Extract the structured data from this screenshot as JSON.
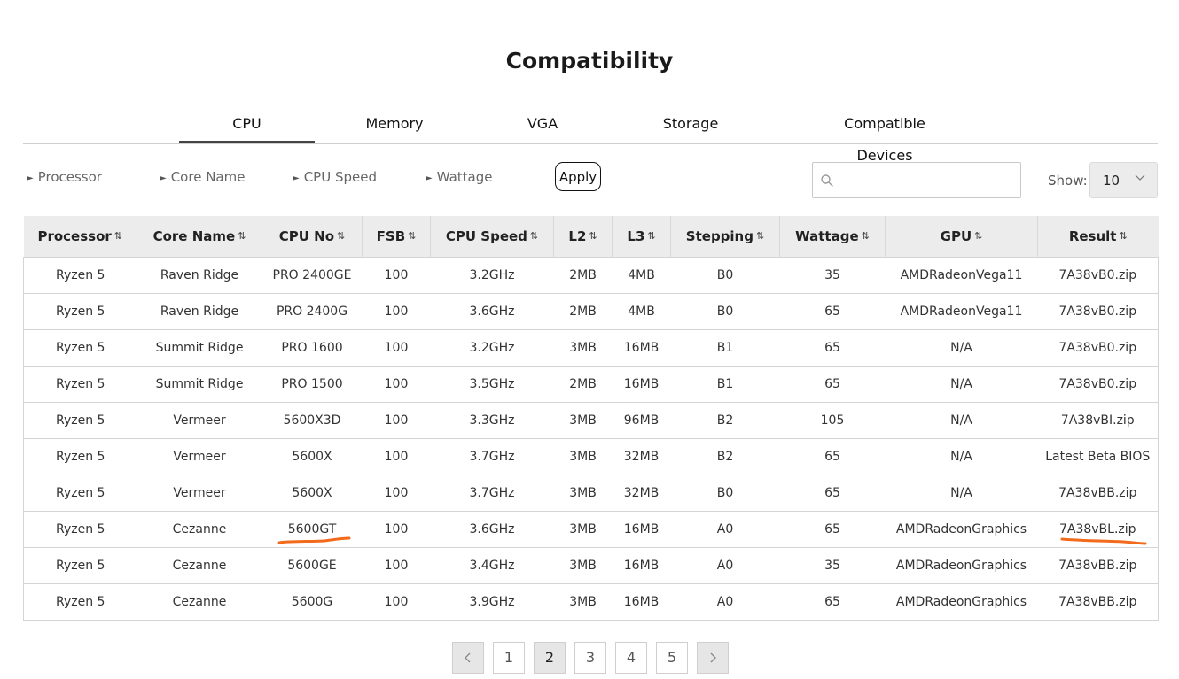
{
  "page": {
    "title": "Compatibility"
  },
  "tabs": [
    {
      "label": "CPU",
      "active": true
    },
    {
      "label": "Memory"
    },
    {
      "label": "VGA"
    },
    {
      "label": "Storage"
    },
    {
      "label": "Compatible Devices"
    }
  ],
  "filters": [
    {
      "label": "Processor"
    },
    {
      "label": "Core Name"
    },
    {
      "label": "CPU Speed"
    },
    {
      "label": "Wattage"
    }
  ],
  "apply_label": "Apply",
  "search": {
    "value": "",
    "placeholder": ""
  },
  "show": {
    "label": "Show:",
    "value": "10"
  },
  "table": {
    "columns": [
      "Processor",
      "Core Name",
      "CPU No",
      "FSB",
      "CPU Speed",
      "L2",
      "L3",
      "Stepping",
      "Wattage",
      "GPU",
      "Result"
    ],
    "rows": [
      [
        "Ryzen 5",
        "Raven Ridge",
        "PRO 2400GE",
        "100",
        "3.2GHz",
        "2MB",
        "4MB",
        "B0",
        "35",
        "AMDRadeonVega11",
        "7A38vB0.zip"
      ],
      [
        "Ryzen 5",
        "Raven Ridge",
        "PRO 2400G",
        "100",
        "3.6GHz",
        "2MB",
        "4MB",
        "B0",
        "65",
        "AMDRadeonVega11",
        "7A38vB0.zip"
      ],
      [
        "Ryzen 5",
        "Summit Ridge",
        "PRO 1600",
        "100",
        "3.2GHz",
        "3MB",
        "16MB",
        "B1",
        "65",
        "N/A",
        "7A38vB0.zip"
      ],
      [
        "Ryzen 5",
        "Summit Ridge",
        "PRO 1500",
        "100",
        "3.5GHz",
        "2MB",
        "16MB",
        "B1",
        "65",
        "N/A",
        "7A38vB0.zip"
      ],
      [
        "Ryzen 5",
        "Vermeer",
        "5600X3D",
        "100",
        "3.3GHz",
        "3MB",
        "96MB",
        "B2",
        "105",
        "N/A",
        "7A38vBI.zip"
      ],
      [
        "Ryzen 5",
        "Vermeer",
        "5600X",
        "100",
        "3.7GHz",
        "3MB",
        "32MB",
        "B2",
        "65",
        "N/A",
        "Latest Beta BIOS"
      ],
      [
        "Ryzen 5",
        "Vermeer",
        "5600X",
        "100",
        "3.7GHz",
        "3MB",
        "32MB",
        "B0",
        "65",
        "N/A",
        "7A38vBB.zip"
      ],
      [
        "Ryzen 5",
        "Cezanne",
        "5600GT",
        "100",
        "3.6GHz",
        "3MB",
        "16MB",
        "A0",
        "65",
        "AMDRadeonGraphics",
        "7A38vBL.zip"
      ],
      [
        "Ryzen 5",
        "Cezanne",
        "5600GE",
        "100",
        "3.4GHz",
        "3MB",
        "16MB",
        "A0",
        "35",
        "AMDRadeonGraphics",
        "7A38vBB.zip"
      ],
      [
        "Ryzen 5",
        "Cezanne",
        "5600G",
        "100",
        "3.9GHz",
        "3MB",
        "16MB",
        "A0",
        "65",
        "AMDRadeonGraphics",
        "7A38vBB.zip"
      ]
    ]
  },
  "pagination": {
    "pages": [
      "1",
      "2",
      "3",
      "4",
      "5"
    ],
    "current": "2"
  },
  "annotation_color": "#f26a1b"
}
